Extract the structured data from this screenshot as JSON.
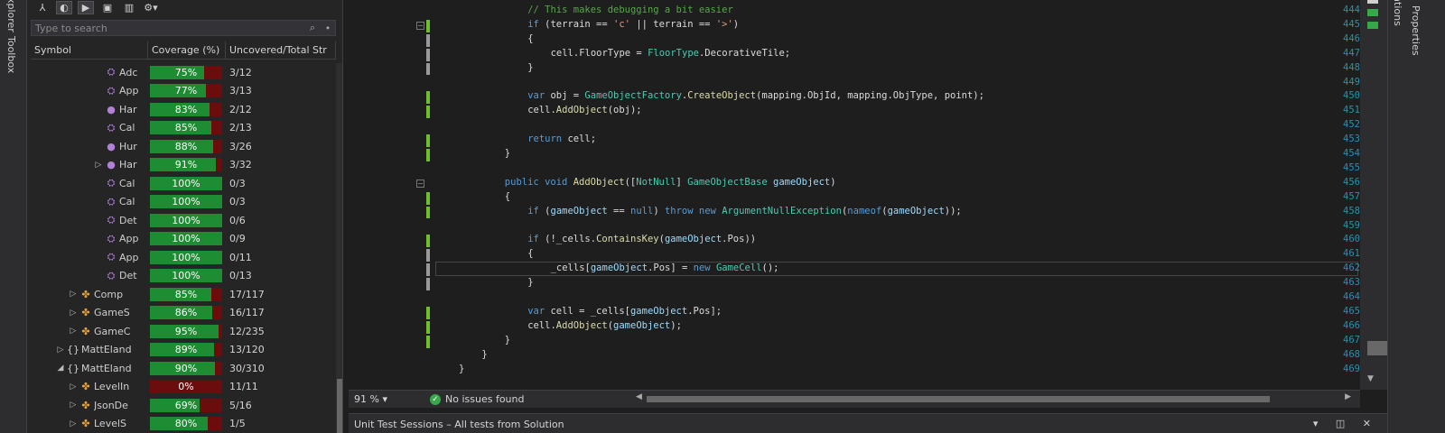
{
  "left_strip": {
    "tabs": [
      "Explorer",
      "Toolbox"
    ]
  },
  "coverage_panel": {
    "toolbar": {
      "icons": [
        "filter-icon",
        "coverage-icon",
        "run-icon",
        "save-icon",
        "delete-icon",
        "settings-icon"
      ]
    },
    "search": {
      "placeholder": "Type to search"
    },
    "columns": {
      "symbol": "Symbol",
      "coverage": "Coverage (%)",
      "uncovered": "Uncovered/Total Str"
    },
    "rows": [
      {
        "indent": 5,
        "expander": "",
        "icon": "method",
        "name": "Adc",
        "pct": 75,
        "label": "75%",
        "unc": "3/12"
      },
      {
        "indent": 5,
        "expander": "",
        "icon": "method",
        "name": "App",
        "pct": 77,
        "label": "77%",
        "unc": "3/13"
      },
      {
        "indent": 5,
        "expander": "",
        "icon": "method-dot",
        "name": "Har",
        "pct": 83,
        "label": "83%",
        "unc": "2/12"
      },
      {
        "indent": 5,
        "expander": "",
        "icon": "method",
        "name": "Cal",
        "pct": 85,
        "label": "85%",
        "unc": "2/13"
      },
      {
        "indent": 5,
        "expander": "",
        "icon": "method-dot",
        "name": "Hur",
        "pct": 88,
        "label": "88%",
        "unc": "3/26"
      },
      {
        "indent": 5,
        "expander": "▷",
        "icon": "method-dot",
        "name": "Har",
        "pct": 91,
        "label": "91%",
        "unc": "3/32"
      },
      {
        "indent": 5,
        "expander": "",
        "icon": "method",
        "name": "Cal",
        "pct": 100,
        "label": "100%",
        "unc": "0/3"
      },
      {
        "indent": 5,
        "expander": "",
        "icon": "method",
        "name": "Cal",
        "pct": 100,
        "label": "100%",
        "unc": "0/3"
      },
      {
        "indent": 5,
        "expander": "",
        "icon": "method",
        "name": "Det",
        "pct": 100,
        "label": "100%",
        "unc": "0/6"
      },
      {
        "indent": 5,
        "expander": "",
        "icon": "method",
        "name": "App",
        "pct": 100,
        "label": "100%",
        "unc": "0/9"
      },
      {
        "indent": 5,
        "expander": "",
        "icon": "method",
        "name": "App",
        "pct": 100,
        "label": "100%",
        "unc": "0/11"
      },
      {
        "indent": 5,
        "expander": "",
        "icon": "method",
        "name": "Det",
        "pct": 100,
        "label": "100%",
        "unc": "0/13"
      },
      {
        "indent": 3,
        "expander": "▷",
        "icon": "class",
        "name": "Comp",
        "pct": 85,
        "label": "85%",
        "unc": "17/117"
      },
      {
        "indent": 3,
        "expander": "▷",
        "icon": "class",
        "name": "GameS",
        "pct": 86,
        "label": "86%",
        "unc": "16/117"
      },
      {
        "indent": 3,
        "expander": "▷",
        "icon": "class",
        "name": "GameC",
        "pct": 95,
        "label": "95%",
        "unc": "12/235"
      },
      {
        "indent": 2,
        "expander": "▷",
        "icon": "namespace",
        "name": "MattEland",
        "pct": 89,
        "label": "89%",
        "unc": "13/120"
      },
      {
        "indent": 2,
        "expander": "◢",
        "icon": "namespace",
        "name": "MattEland",
        "pct": 90,
        "label": "90%",
        "unc": "30/310"
      },
      {
        "indent": 3,
        "expander": "▷",
        "icon": "class",
        "name": "LevelIn",
        "pct": 0,
        "label": "0%",
        "unc": "11/11"
      },
      {
        "indent": 3,
        "expander": "▷",
        "icon": "class",
        "name": "JsonDe",
        "pct": 69,
        "label": "69%",
        "unc": "5/16"
      },
      {
        "indent": 3,
        "expander": "▷",
        "icon": "class",
        "name": "LevelS",
        "pct": 80,
        "label": "80%",
        "unc": "1/5"
      }
    ]
  },
  "editor": {
    "lines": [
      {
        "num": "444",
        "indent": 12,
        "bar": "",
        "fold": "",
        "tokens": [
          [
            "c",
            "// This makes debugging a bit easier"
          ]
        ]
      },
      {
        "num": "445",
        "indent": 12,
        "bar": "green",
        "fold": "⊟",
        "tokens": [
          [
            "k",
            "if"
          ],
          [
            "p",
            " (terrain == "
          ],
          [
            "s",
            "'c'"
          ],
          [
            "p",
            " || terrain == "
          ],
          [
            "s",
            "'>'"
          ],
          [
            "p",
            ")"
          ]
        ]
      },
      {
        "num": "446",
        "indent": 12,
        "bar": "gray",
        "fold": "",
        "tokens": [
          [
            "p",
            "{"
          ]
        ]
      },
      {
        "num": "447",
        "indent": 16,
        "bar": "gray",
        "fold": "",
        "tokens": [
          [
            "p",
            "cell.FloorType = "
          ],
          [
            "t",
            "FloorType"
          ],
          [
            "p",
            ".DecorativeTile;"
          ]
        ]
      },
      {
        "num": "448",
        "indent": 12,
        "bar": "gray",
        "fold": "",
        "tokens": [
          [
            "p",
            "}"
          ]
        ]
      },
      {
        "num": "449",
        "indent": 0,
        "bar": "",
        "fold": "",
        "tokens": []
      },
      {
        "num": "450",
        "indent": 12,
        "bar": "green",
        "fold": "",
        "tokens": [
          [
            "k",
            "var"
          ],
          [
            "p",
            " obj = "
          ],
          [
            "t",
            "GameObjectFactory"
          ],
          [
            "p",
            "."
          ],
          [
            "m",
            "CreateObject"
          ],
          [
            "p",
            "(mapping.ObjId, mapping.ObjType, point);"
          ]
        ]
      },
      {
        "num": "451",
        "indent": 12,
        "bar": "green",
        "fold": "",
        "tokens": [
          [
            "p",
            "cell."
          ],
          [
            "m",
            "AddObject"
          ],
          [
            "p",
            "(obj);"
          ]
        ]
      },
      {
        "num": "452",
        "indent": 0,
        "bar": "",
        "fold": "",
        "tokens": []
      },
      {
        "num": "453",
        "indent": 12,
        "bar": "green",
        "fold": "",
        "tokens": [
          [
            "k",
            "return"
          ],
          [
            "p",
            " cell;"
          ]
        ]
      },
      {
        "num": "454",
        "indent": 8,
        "bar": "green",
        "fold": "",
        "tokens": [
          [
            "p",
            "}"
          ]
        ]
      },
      {
        "num": "455",
        "indent": 0,
        "bar": "",
        "fold": "",
        "tokens": []
      },
      {
        "num": "456",
        "indent": 8,
        "bar": "",
        "fold": "⊟",
        "tokens": [
          [
            "k",
            "public"
          ],
          [
            "p",
            " "
          ],
          [
            "k",
            "void"
          ],
          [
            "p",
            " "
          ],
          [
            "m",
            "AddObject"
          ],
          [
            "p",
            "(["
          ],
          [
            "t",
            "NotNull"
          ],
          [
            "p",
            "] "
          ],
          [
            "t",
            "GameObjectBase"
          ],
          [
            "p",
            " "
          ],
          [
            "a",
            "gameObject"
          ],
          [
            "p",
            ")"
          ]
        ]
      },
      {
        "num": "457",
        "indent": 8,
        "bar": "green",
        "fold": "",
        "tokens": [
          [
            "p",
            "{"
          ]
        ]
      },
      {
        "num": "458",
        "indent": 12,
        "bar": "green",
        "fold": "",
        "tokens": [
          [
            "k",
            "if"
          ],
          [
            "p",
            " ("
          ],
          [
            "a",
            "gameObject"
          ],
          [
            "p",
            " == "
          ],
          [
            "k",
            "null"
          ],
          [
            "p",
            ") "
          ],
          [
            "k",
            "throw"
          ],
          [
            "p",
            " "
          ],
          [
            "k",
            "new"
          ],
          [
            "p",
            " "
          ],
          [
            "t",
            "ArgumentNullException"
          ],
          [
            "p",
            "("
          ],
          [
            "k",
            "nameof"
          ],
          [
            "p",
            "("
          ],
          [
            "a",
            "gameObject"
          ],
          [
            "p",
            "));"
          ]
        ]
      },
      {
        "num": "459",
        "indent": 0,
        "bar": "",
        "fold": "",
        "tokens": []
      },
      {
        "num": "460",
        "indent": 12,
        "bar": "green",
        "fold": "",
        "tokens": [
          [
            "k",
            "if"
          ],
          [
            "p",
            " (!_cells."
          ],
          [
            "m",
            "ContainsKey"
          ],
          [
            "p",
            "("
          ],
          [
            "a",
            "gameObject"
          ],
          [
            "p",
            ".Pos))"
          ]
        ]
      },
      {
        "num": "461",
        "indent": 12,
        "bar": "gray",
        "fold": "",
        "tokens": [
          [
            "p",
            "{"
          ]
        ]
      },
      {
        "num": "462",
        "indent": 16,
        "bar": "gray",
        "fold": "",
        "tokens": [
          [
            "p",
            "_cells["
          ],
          [
            "a",
            "gameObject"
          ],
          [
            "p",
            ".Pos] = "
          ],
          [
            "k",
            "new"
          ],
          [
            "p",
            " "
          ],
          [
            "t",
            "GameCell"
          ],
          [
            "p",
            "();"
          ]
        ]
      },
      {
        "num": "463",
        "indent": 12,
        "bar": "gray",
        "fold": "",
        "tokens": [
          [
            "p",
            "}"
          ]
        ]
      },
      {
        "num": "464",
        "indent": 0,
        "bar": "",
        "fold": "",
        "tokens": []
      },
      {
        "num": "465",
        "indent": 12,
        "bar": "green",
        "fold": "",
        "tokens": [
          [
            "k",
            "var"
          ],
          [
            "p",
            " cell = _cells["
          ],
          [
            "a",
            "gameObject"
          ],
          [
            "p",
            ".Pos];"
          ]
        ]
      },
      {
        "num": "466",
        "indent": 12,
        "bar": "green",
        "fold": "",
        "tokens": [
          [
            "p",
            "cell."
          ],
          [
            "m",
            "AddObject"
          ],
          [
            "p",
            "("
          ],
          [
            "a",
            "gameObject"
          ],
          [
            "p",
            ");"
          ]
        ]
      },
      {
        "num": "467",
        "indent": 8,
        "bar": "green",
        "fold": "",
        "tokens": [
          [
            "p",
            "}"
          ]
        ]
      },
      {
        "num": "468",
        "indent": 4,
        "bar": "",
        "fold": "",
        "tokens": [
          [
            "p",
            "}"
          ]
        ]
      },
      {
        "num": "469",
        "indent": 0,
        "bar": "",
        "fold": "",
        "tokens": [
          [
            "p",
            "}"
          ]
        ]
      }
    ],
    "current_line_index": 18
  },
  "status": {
    "zoom": "91 %",
    "issues": "No issues found"
  },
  "right_strip": {
    "tabs": [
      "Notifications",
      "Properties"
    ]
  },
  "bottom_panel": {
    "title": "Unit Test Sessions – All tests from Solution",
    "controls": "▾ ◫ ✕"
  },
  "colors": {
    "covered": "#1e8c32",
    "uncovered": "#6b0d0d",
    "change_bar": "#6fbf2b"
  }
}
